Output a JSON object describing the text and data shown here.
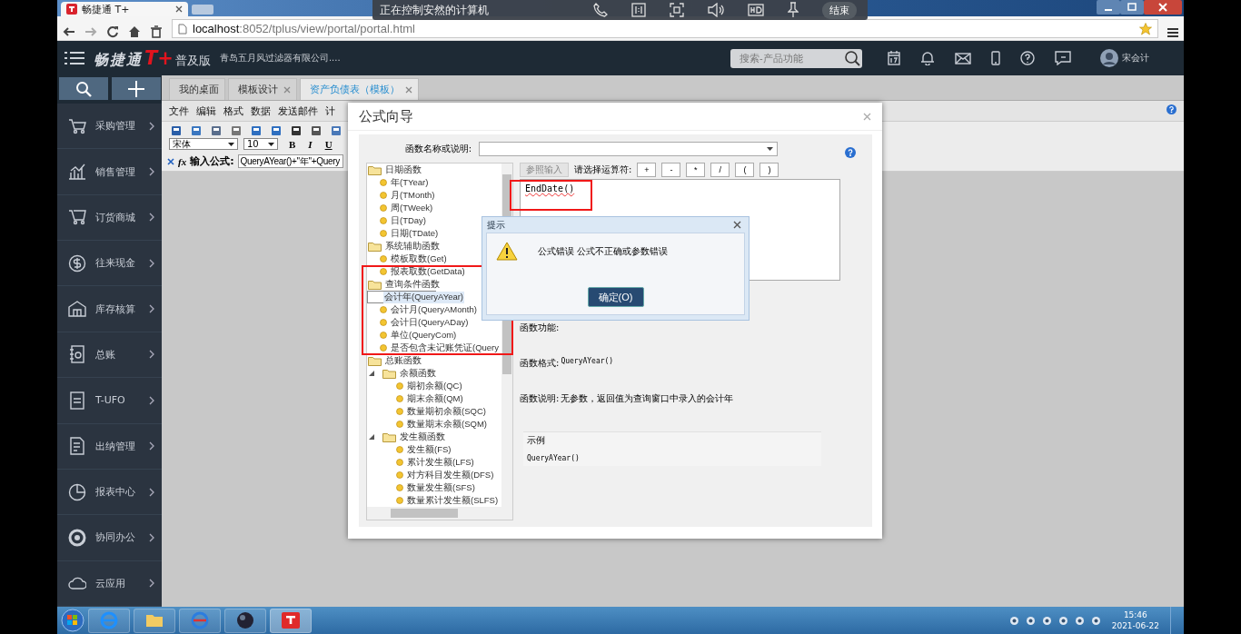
{
  "browser": {
    "tab_title": "畅捷通 T+",
    "url_host": "localhost",
    "url_path": ":8052/tplus/view/portal/portal.html"
  },
  "remote_bar": {
    "title": "正在控制安然的计算机",
    "end_button": "结束"
  },
  "header": {
    "brand": "畅捷通",
    "brand_mark": "T+",
    "edition": "普及版",
    "company": "青岛五月风过滤器有限公司....",
    "search": {
      "placeholder": "搜索-产品功能"
    },
    "user": "宋会计"
  },
  "sidebar": {
    "items": [
      {
        "label": "采购管理"
      },
      {
        "label": "销售管理"
      },
      {
        "label": "订货商城"
      },
      {
        "label": "往来现金"
      },
      {
        "label": "库存核算"
      },
      {
        "label": "总账"
      },
      {
        "label": "T-UFO"
      },
      {
        "label": "出纳管理"
      },
      {
        "label": "报表中心"
      },
      {
        "label": "协同办公"
      },
      {
        "label": "云应用"
      }
    ]
  },
  "tabs": [
    {
      "label": "我的桌面",
      "closable": false,
      "selected": false
    },
    {
      "label": "模板设计",
      "closable": true,
      "selected": false
    },
    {
      "label": "资产负债表（模板）",
      "closable": true,
      "selected": true
    }
  ],
  "menu": [
    "文件",
    "编辑",
    "格式",
    "数据",
    "发送邮件",
    "计"
  ],
  "format_bar": {
    "font": "宋体",
    "size": "10",
    "buttons": [
      "B",
      "I",
      "U"
    ]
  },
  "formula_bar": {
    "fx": "fx",
    "label": "输入公式:",
    "value": "QueryAYear()+\"年\"+Query"
  },
  "formula_wizard": {
    "title": "公式向导",
    "search_label": "函数名称或说明:",
    "tree": [
      {
        "label": "日期函数",
        "kind": "folder",
        "selected": false,
        "children": [
          {
            "label": "年(TYear)",
            "kind": "leaf",
            "selected": false
          },
          {
            "label": "月(TMonth)",
            "kind": "leaf",
            "selected": false
          },
          {
            "label": "周(TWeek)",
            "kind": "leaf",
            "selected": false
          },
          {
            "label": "日(TDay)",
            "kind": "leaf",
            "selected": false
          },
          {
            "label": "日期(TDate)",
            "kind": "leaf",
            "selected": false
          }
        ]
      },
      {
        "label": "系统辅助函数",
        "kind": "folder",
        "selected": false,
        "children": [
          {
            "label": "模板取数(Get)",
            "kind": "leaf",
            "selected": false
          },
          {
            "label": "报表取数(GetData)",
            "kind": "leaf",
            "selected": false
          }
        ]
      },
      {
        "label": "查询条件函数",
        "kind": "folder",
        "selected": false,
        "children": [
          {
            "label": "会计年(QueryAYear)",
            "kind": "leaf",
            "selected": true
          },
          {
            "label": "会计月(QueryAMonth)",
            "kind": "leaf",
            "selected": false
          },
          {
            "label": "会计日(QueryADay)",
            "kind": "leaf",
            "selected": false
          },
          {
            "label": "单位(QueryCom)",
            "kind": "leaf",
            "selected": false
          },
          {
            "label": "是否包含未记账凭证(Query",
            "kind": "leaf",
            "selected": false
          }
        ]
      },
      {
        "label": "总账函数",
        "kind": "folder",
        "selected": false,
        "children": [
          {
            "label": "余额函数",
            "kind": "subfolder",
            "selected": false,
            "children": [
              {
                "label": "期初余额(QC)",
                "kind": "leaf",
                "selected": false
              },
              {
                "label": "期末余额(QM)",
                "kind": "leaf",
                "selected": false
              },
              {
                "label": "数量期初余额(SQC)",
                "kind": "leaf",
                "selected": false
              },
              {
                "label": "数量期末余额(SQM)",
                "kind": "leaf",
                "selected": false
              }
            ]
          },
          {
            "label": "发生额函数",
            "kind": "subfolder",
            "selected": false,
            "children": [
              {
                "label": "发生额(FS)",
                "kind": "leaf",
                "selected": false
              },
              {
                "label": "累计发生额(LFS)",
                "kind": "leaf",
                "selected": false
              },
              {
                "label": "对方科目发生额(DFS)",
                "kind": "leaf",
                "selected": false
              },
              {
                "label": "数量发生额(SFS)",
                "kind": "leaf",
                "selected": false
              },
              {
                "label": "数量累计发生额(SLFS)",
                "kind": "leaf",
                "selected": false
              }
            ]
          }
        ]
      }
    ],
    "reference_button": {
      "label": "参照输入",
      "disabled": true
    },
    "operator_label": "请选择运算符:",
    "operators": [
      "+",
      "-",
      "*",
      "/",
      "(",
      ")"
    ],
    "formula": "EndDate()",
    "function_label": "函数功能:",
    "format_label": "函数格式:",
    "format_value": "QueryAYear()",
    "description_label": "函数说明:",
    "description_value": "无参数，返回值为查询窗口中录入的会计年",
    "example_title": "示例",
    "example_value": "QueryAYear()"
  },
  "alert": {
    "title": "提示",
    "message": "公式错误  公式不正确或参数错误",
    "ok_button": "确定(O)"
  },
  "taskbar": {
    "time": "15:46",
    "date": "2021-06-22"
  }
}
